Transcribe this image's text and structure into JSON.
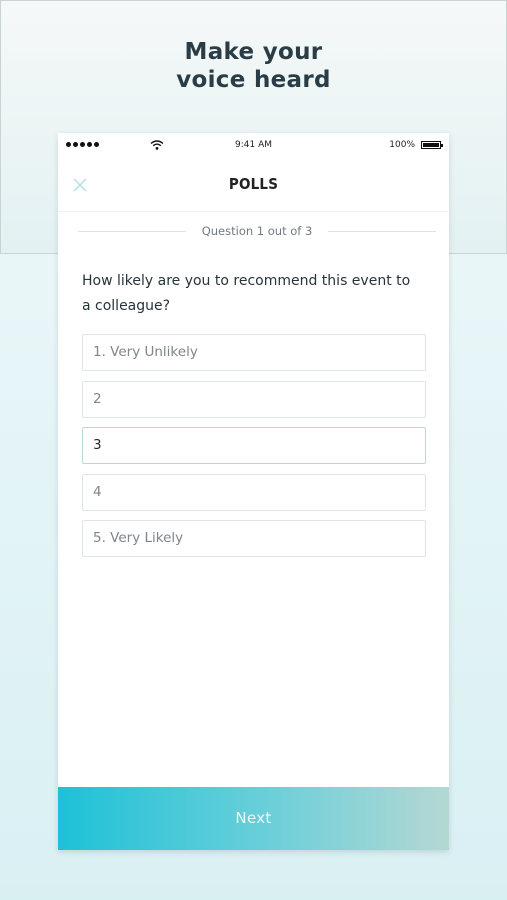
{
  "promo": {
    "headline_line1": "Make your",
    "headline_line2": "voice heard"
  },
  "status_bar": {
    "time": "9:41 AM",
    "battery": "100%"
  },
  "nav": {
    "title": "POLLS",
    "close_icon": "close-icon"
  },
  "progress": {
    "label": "Question 1 out of 3",
    "current": 1,
    "total": 3
  },
  "question": {
    "text": "How likely are you to recommend this event to a colleague?"
  },
  "options": [
    {
      "label": "1. Very Unlikely",
      "selected": false
    },
    {
      "label": "2",
      "selected": false
    },
    {
      "label": "3",
      "selected": true
    },
    {
      "label": "4",
      "selected": false
    },
    {
      "label": "5. Very Likely",
      "selected": false
    }
  ],
  "actions": {
    "next_label": "Next"
  },
  "colors": {
    "accent": "#1dc1d8",
    "close_icon": "#b8dfe3",
    "headline": "#2a3d46"
  }
}
